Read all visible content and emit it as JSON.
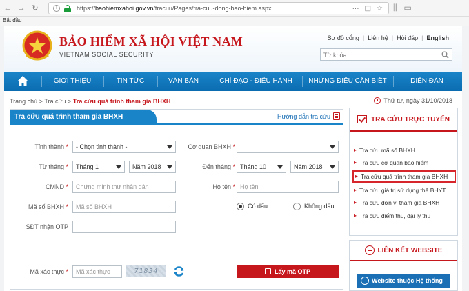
{
  "browser": {
    "url_domain": "baohiemxahoi.gov.vn",
    "url_path": "/tracuu/Pages/tra-cuu-dong-bao-hiem.aspx",
    "url_scheme": "https://",
    "bookmark": "Bắt đầu"
  },
  "header": {
    "title": "BẢO HIỂM XÃ HỘI VIỆT NAM",
    "subtitle": "VIETNAM SOCIAL SECURITY",
    "links": [
      "Sơ đồ cổng",
      "Liên hệ",
      "Hỏi đáp",
      "English"
    ],
    "search_placeholder": "Từ khóa"
  },
  "nav": {
    "items": [
      "GIỚI THIỆU",
      "TIN TỨC",
      "VĂN BẢN",
      "CHỈ ĐẠO - ĐIỀU HÀNH",
      "NHỮNG ĐIỀU CẦN BIẾT",
      "DIỄN ĐÀN"
    ]
  },
  "breadcrumb": {
    "home": "Trang chủ",
    "sep": ">",
    "parent": "Tra cứu",
    "current": "Tra cứu quá trình tham gia BHXH"
  },
  "date_text": "Thứ tư, ngày 31/10/2018",
  "form": {
    "title": "Tra cứu quá trình tham gia BHXH",
    "guide": "Hướng dẫn tra cứu",
    "province_label": "Tỉnh thành",
    "province_value": "- Chọn tỉnh thành -",
    "agency_label": "Cơ quan BHXH",
    "agency_value": "",
    "from_label": "Từ tháng",
    "from_month": "Tháng 1",
    "from_year": "Năm 2018",
    "to_label": "Đến tháng",
    "to_month": "Tháng 10",
    "to_year": "Năm 2018",
    "id_label": "CMND",
    "id_placeholder": "Chứng minh thư nhân dân",
    "name_label": "Họ tên",
    "name_placeholder": "Họ tên",
    "code_label": "Mã số BHXH",
    "code_placeholder": "Mã số BHXH",
    "accent_yes": "Có dấu",
    "accent_no": "Không dấu",
    "phone_label": "SĐT nhận OTP",
    "captcha_label": "Mã xác thực",
    "captcha_placeholder": "Mã xác thực",
    "captcha_code": "71834",
    "otp_button": "Lấy mã OTP",
    "required": "*"
  },
  "sidebar": {
    "title": "TRA CỨU TRỰC TUYẾN",
    "items": [
      "Tra cứu mã số BHXH",
      "Tra cứu cơ quan bảo hiểm",
      "Tra cứu quá trình tham gia BHXH",
      "Tra cứu giá trị sử dụng thẻ BHYT",
      "Tra cứu đơn vị tham gia BHXH",
      "Tra cứu điểm thu, đại lý thu"
    ],
    "links_title": "LIÊN KẾT WEBSITE",
    "site_button": "Website thuộc Hệ thống"
  },
  "colors": {
    "brand_red": "#c6171d",
    "nav_blue": "#0b6cb1"
  }
}
